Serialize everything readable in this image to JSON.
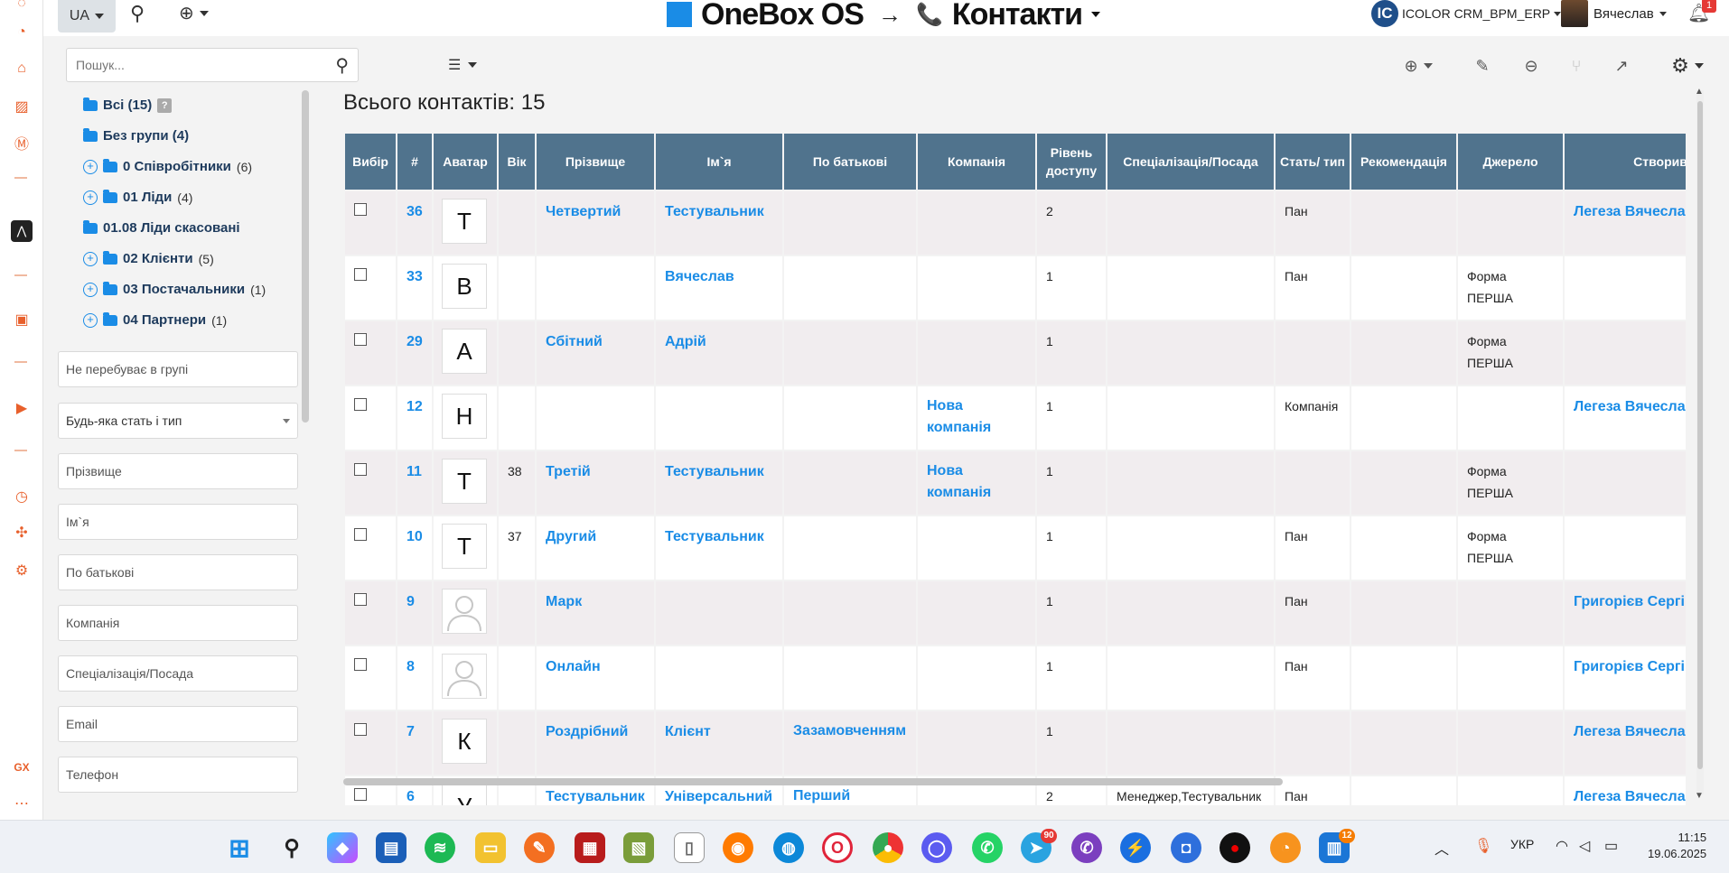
{
  "topbar": {
    "lang": "UA",
    "brand": "OneBox OS",
    "arrow": "→",
    "module": "Контакти",
    "org": "ICOLOR CRM_BPM_ERP",
    "org_logo": "IC",
    "user": "Вячеслав",
    "notifications": "1"
  },
  "filters": {
    "search_placeholder": "Пошук...",
    "groups": [
      {
        "label": "Всі (15)",
        "count": "",
        "has_plus": false,
        "help": "?"
      },
      {
        "label": "Без групи (4)",
        "count": "",
        "has_plus": false,
        "help": ""
      },
      {
        "label": "0 Співробітники",
        "count": "(6)",
        "has_plus": true,
        "help": ""
      },
      {
        "label": "01 Ліди",
        "count": "(4)",
        "has_plus": true,
        "help": ""
      },
      {
        "label": "01.08 Ліди скасовані",
        "count": "",
        "has_plus": false,
        "help": ""
      },
      {
        "label": "02 Клієнти",
        "count": "(5)",
        "has_plus": true,
        "help": ""
      },
      {
        "label": "03 Постачальники",
        "count": "(1)",
        "has_plus": true,
        "help": ""
      },
      {
        "label": "04 Партнери",
        "count": "(1)",
        "has_plus": true,
        "help": ""
      }
    ],
    "fields": [
      {
        "placeholder": "Не перебуває в групі"
      },
      {
        "placeholder": "Будь-яка стать і тип",
        "select": true
      },
      {
        "placeholder": "Прізвище"
      },
      {
        "placeholder": "Ім`я"
      },
      {
        "placeholder": "По батькові"
      },
      {
        "placeholder": "Компанія"
      },
      {
        "placeholder": "Спеціалізація/Посада"
      },
      {
        "placeholder": "Email"
      },
      {
        "placeholder": "Телефон"
      }
    ]
  },
  "main": {
    "title": "Всього контактів: 15",
    "columns": [
      "Вибір",
      "#",
      "Аватар",
      "Вік",
      "Прізвище",
      "Ім`я",
      "По батькові",
      "Компанія",
      "Рівень доступу",
      "Спеціалізація/Посада",
      "Стать/ тип",
      "Рекомендація",
      "Джерело",
      "Створив"
    ],
    "rows": [
      {
        "id": "36",
        "avatar": "Т",
        "age": "",
        "last": "Четвертий",
        "first": "Тестувальник",
        "middle": "",
        "company": "",
        "access": "2",
        "position": "",
        "gender": "Пан",
        "rec": "",
        "source": "",
        "creator": "Легеза Вячеслав"
      },
      {
        "id": "33",
        "avatar": "В",
        "age": "",
        "last": "",
        "first": "Вячеслав",
        "middle": "",
        "company": "",
        "access": "1",
        "position": "",
        "gender": "Пан",
        "rec": "",
        "source": "Форма ПЕРША",
        "creator": ""
      },
      {
        "id": "29",
        "avatar": "А",
        "age": "",
        "last": "Сбітний",
        "first": "Адрій",
        "middle": "",
        "company": "",
        "access": "1",
        "position": "",
        "gender": "",
        "rec": "",
        "source": "Форма ПЕРША",
        "creator": ""
      },
      {
        "id": "12",
        "avatar": "Н",
        "age": "",
        "last": "",
        "first": "",
        "middle": "",
        "company": "Нова компанія",
        "access": "1",
        "position": "",
        "gender": "Компанія",
        "rec": "",
        "source": "",
        "creator": "Легеза Вячеслав"
      },
      {
        "id": "11",
        "avatar": "Т",
        "age": "38",
        "last": "Третій",
        "first": "Тестувальник",
        "middle": "",
        "company": "Нова компанія",
        "access": "1",
        "position": "",
        "gender": "",
        "rec": "",
        "source": "Форма ПЕРША",
        "creator": ""
      },
      {
        "id": "10",
        "avatar": "Т",
        "age": "37",
        "last": "Другий",
        "first": "Тестувальник",
        "middle": "",
        "company": "",
        "access": "1",
        "position": "",
        "gender": "Пан",
        "rec": "",
        "source": "Форма ПЕРША",
        "creator": ""
      },
      {
        "id": "9",
        "avatar": "",
        "age": "",
        "last": "Марк",
        "first": "",
        "middle": "",
        "company": "",
        "access": "1",
        "position": "",
        "gender": "Пан",
        "rec": "",
        "source": "",
        "creator": "Григорієв Сергій"
      },
      {
        "id": "8",
        "avatar": "",
        "age": "",
        "last": "Онлайн",
        "first": "",
        "middle": "",
        "company": "",
        "access": "1",
        "position": "",
        "gender": "Пан",
        "rec": "",
        "source": "",
        "creator": "Григорієв Сергій"
      },
      {
        "id": "7",
        "avatar": "К",
        "age": "",
        "last": "Роздрібний",
        "first": "Клієнт",
        "middle": "Зазамовченням",
        "company": "",
        "access": "1",
        "position": "",
        "gender": "",
        "rec": "",
        "source": "",
        "creator": "Легеза Вячеслав"
      },
      {
        "id": "6",
        "avatar": "У",
        "age": "",
        "last": "Тестувальник",
        "first": "Універсальний",
        "middle": "Перший",
        "company": "",
        "access": "2",
        "position": "Менеджер,Тестувальник",
        "gender": "Пан",
        "rec": "",
        "source": "",
        "creator": "Легеза Вячеслав"
      }
    ]
  },
  "taskbar": {
    "lang": "УКР",
    "time": "11:15",
    "date": "19.06.2025",
    "badges": {
      "telegram": "90",
      "store": "12"
    }
  }
}
